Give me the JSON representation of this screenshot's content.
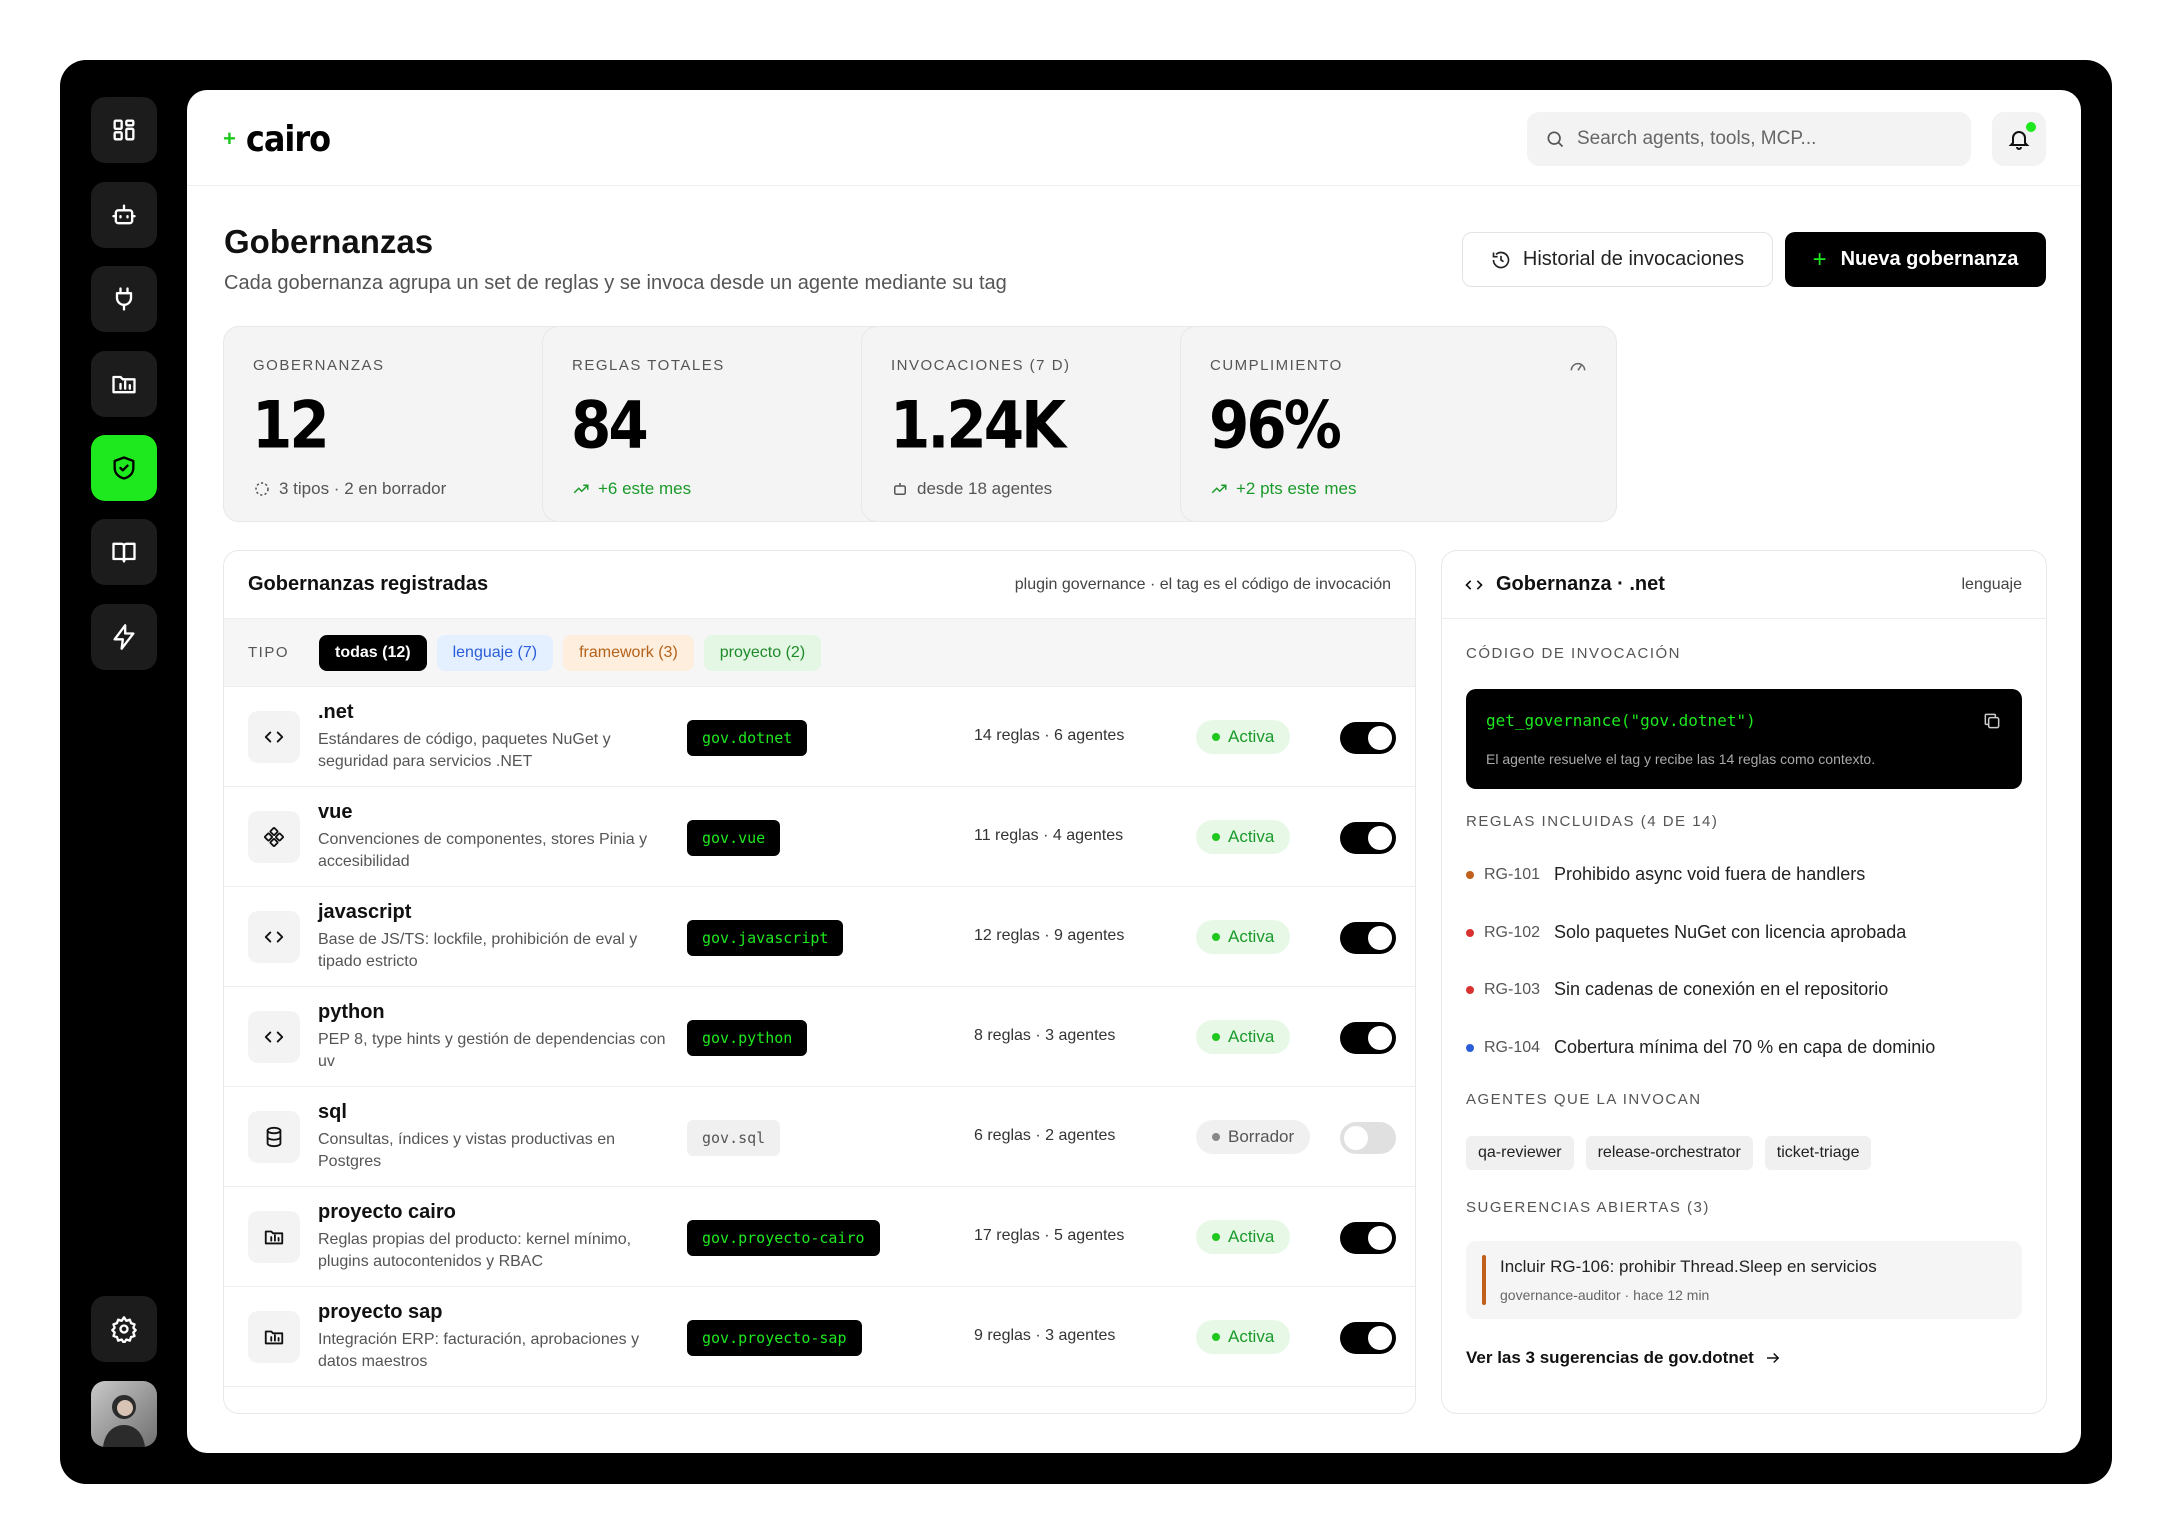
{
  "app": {
    "logo": "cairo"
  },
  "search": {
    "placeholder": "Search agents, tools, MCP..."
  },
  "header": {
    "title": "Gobernanzas",
    "subtitle": "Cada gobernanza agrupa un set de reglas y se invoca desde un agente mediante su tag",
    "history_label": "Historial de invocaciones",
    "new_label": "Nueva gobernanza"
  },
  "stats": [
    {
      "label": "GOBERNANZAS",
      "value": "12",
      "note": "3 tipos · 2 en borrador",
      "icon": "balance-scale-icon"
    },
    {
      "label": "REGLAS TOTALES",
      "value": "84",
      "note": "+6 este mes",
      "icon": "checklist-icon"
    },
    {
      "label": "INVOCACIONES (7 D)",
      "value": "1.24K",
      "note": "desde 18 agentes",
      "icon": "broadcast-icon"
    },
    {
      "label": "CUMPLIMIENTO",
      "value": "96%",
      "note": "+2 pts este mes",
      "icon": "gauge-icon"
    }
  ],
  "list": {
    "title": "Gobernanzas registradas",
    "meta": "plugin governance · el tag es el código de invocación",
    "filter_label": "TIPO",
    "filters": [
      "todas (12)",
      "lenguaje (7)",
      "framework (3)",
      "proyecto (2)"
    ],
    "rows": [
      {
        "name": ".net",
        "desc": "Estándares de código, paquetes NuGet y seguridad para servicios .NET",
        "tag": "gov.dotnet",
        "counts": "14 reglas · 6 agentes",
        "status": "Activa",
        "icon": "code-icon"
      },
      {
        "name": "vue",
        "desc": "Convenciones de componentes, stores Pinia y accesibilidad",
        "tag": "gov.vue",
        "counts": "11 reglas · 4 agentes",
        "status": "Activa",
        "icon": "component-icon"
      },
      {
        "name": "javascript",
        "desc": "Base de JS/TS: lockfile, prohibición de eval y tipado estricto",
        "tag": "gov.javascript",
        "counts": "12 reglas · 9 agentes",
        "status": "Activa",
        "icon": "code-icon"
      },
      {
        "name": "python",
        "desc": "PEP 8, type hints y gestión de dependencias con uv",
        "tag": "gov.python",
        "counts": "8 reglas · 3 agentes",
        "status": "Activa",
        "icon": "code-icon"
      },
      {
        "name": "sql",
        "desc": "Consultas, índices y vistas productivas en Postgres",
        "tag": "gov.sql",
        "counts": "6 reglas · 2 agentes",
        "status": "Borrador",
        "icon": "database-icon"
      },
      {
        "name": "proyecto cairo",
        "desc": "Reglas propias del producto: kernel mínimo, plugins autocontenidos y RBAC",
        "tag": "gov.proyecto-cairo",
        "counts": "17 reglas · 5 agentes",
        "status": "Activa",
        "icon": "folder-chart-icon"
      },
      {
        "name": "proyecto sap",
        "desc": "Integración ERP: facturación, aprobaciones y datos maestros",
        "tag": "gov.proyecto-sap",
        "counts": "9 reglas · 3 agentes",
        "status": "Activa",
        "icon": "folder-chart-icon"
      }
    ]
  },
  "detail": {
    "title": "Gobernanza · .net",
    "type": "lenguaje",
    "code_section": "CÓDIGO DE INVOCACIÓN",
    "code": "get_governance(\"gov.dotnet\")",
    "code_hint": "El agente resuelve el tag y recibe las 14 reglas como contexto.",
    "rules_section": "REGLAS INCLUIDAS (4 DE 14)",
    "rules": [
      {
        "id": "RG-101",
        "text": "Prohibido async void fuera de handlers",
        "color": "#c0601a"
      },
      {
        "id": "RG-102",
        "text": "Solo paquetes NuGet con licencia aprobada",
        "color": "#d93030"
      },
      {
        "id": "RG-103",
        "text": "Sin cadenas de conexión en el repositorio",
        "color": "#d93030"
      },
      {
        "id": "RG-104",
        "text": "Cobertura mínima del 70 % en capa de dominio",
        "color": "#2a5ed8"
      }
    ],
    "agents_section": "AGENTES QUE LA INVOCAN",
    "agents": [
      "qa-reviewer",
      "release-orchestrator",
      "ticket-triage"
    ],
    "suggestions_section": "SUGERENCIAS ABIERTAS (3)",
    "suggestion": {
      "title": "Incluir RG-106: prohibir Thread.Sleep en servicios",
      "meta": "governance-auditor · hace 12 min"
    },
    "more_link": "Ver las 3 sugerencias de gov.dotnet"
  },
  "colors": {
    "accent": "#1ee81e",
    "active_badge": "#e7f8e7",
    "dark": "#000000"
  }
}
